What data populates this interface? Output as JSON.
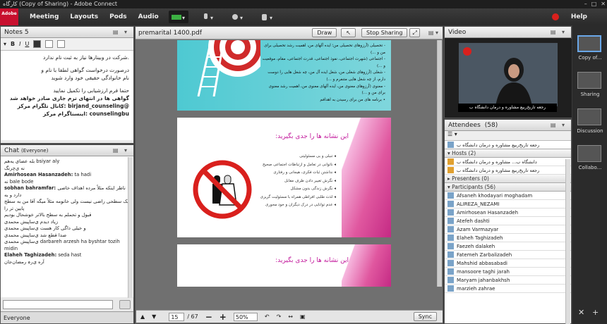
{
  "window": {
    "title": "کارگاه (Copy of Sharing) - Adobe Connect"
  },
  "menu": {
    "items": [
      "Meeting",
      "Layouts",
      "Pods",
      "Audio"
    ],
    "help": "Help"
  },
  "brand": {
    "logo_text": "Adobe"
  },
  "notes": {
    "title": "Notes 5",
    "lines": [
      {
        "text": ".شرکت در وبینارها نیاز به ثبت نام ندارد",
        "bold": false
      },
      {
        "text": "",
        "bold": false
      },
      {
        "text": "درصورت درخواست گواهی لطفا با نام و",
        "bold": false
      },
      {
        "text": "نام خانوادگی حقیقی خود وارد شوید",
        "bold": false
      },
      {
        "text": "",
        "bold": false
      },
      {
        "text": "حتما فرم ارزشیابی را تکمیل نمایید",
        "bold": false
      },
      {
        "text": "گواهی ها در انتهای ترم جاری صادر خواهد شد",
        "bold": true
      },
      {
        "text": "@birjand_counseling :کانال تلگرام مرکز",
        "bold": true
      },
      {
        "text": "counselingbu :اینستاگرام مرکز",
        "bold": true
      }
    ]
  },
  "chat": {
    "title": "Chat",
    "scope": "(Everyone)",
    "footer_label": "Everyone",
    "messages": [
      {
        "who": "",
        "text": "بله عصای یه‌هم bsiyar aly"
      },
      {
        "who": "",
        "text": "نه ی‌چرنگ"
      },
      {
        "who": "Amirhosean Hasanzadeh:",
        "text": " ta hadi"
      },
      {
        "who": "",
        "text": "نه bale bode"
      },
      {
        "who": "sobhan bahramfar:",
        "text": " ناظر اینکه مثلاً مرده اهداف خاصی دارد و به"
      },
      {
        "who": "",
        "text": "یک سطحی راضی نیست ولی خانومه مثلاً میگه آقا من به سطح پایین تر را"
      },
      {
        "who": "",
        "text": "قبول و تحملم به سطح بالاتر خوشحال بودیم"
      },
      {
        "who": "",
        "text": "زیاد دیدم ی‌ساپیش محمد‌ی"
      },
      {
        "who": "",
        "text": "و خیلی داگی کار هست ی‌ساپیش محمد‌ی"
      },
      {
        "who": "",
        "text": "صدا قطع شد ی‌ساپیش محمد‌ی"
      },
      {
        "who": "",
        "text": "ی‌ساپیش محمد‌ی darbareh arzesh ha byshtar tozih midin"
      },
      {
        "who": "Elaheh Taghizadeh:",
        "text": " seda hast"
      },
      {
        "who": "",
        "text": "آره ی‌رہ رمضان‌جان"
      }
    ]
  },
  "share": {
    "file_name": "premarital 1400.pdf",
    "draw_label": "Draw",
    "stop_label": "Stop Sharing",
    "page_current": "15",
    "page_total": "/ 67",
    "zoom": "50%",
    "sync_label": "Sync",
    "slide1_bullets": [
      "- تحصیلی (آرزوهای تحصیلی من؛ ایده آلهای من، اهمیت رشد تحصیلی برای من و ...)",
      "- اجتماعی (شهرت اجتماعی، نفوذ اجتماعی، قدرت اجتماعی، مقام، موقعیت و ...)",
      "- شغلی (آرزوهای شغلی من، شغل ایده آل من، چه شغل هایی را دوست دارم، از چه شغل هایی متنفرم و ...)",
      "- معنوی (آرزوهای معنوی من، ایده آلهای معنوی من، اهمیت رشد معنوی برای من و ...)",
      "• برنامه های من برای رسیدن به اهدافم"
    ],
    "slide2_title": "این نشانه ها را جدی بگیرید:",
    "slide2_bullets": [
      "تنبلی و بی مسئولیتی",
      "ناتوانی در تعامل و ارتباطات اجتماعی صحیح",
      "نداشتن ثبات فکری، هیجانی و رفتاری",
      "نگرش تغییر دادن طرف مقابل",
      "نگرش زندگی بدون مشکل",
      "لذت طلبی افراطی همراه با مسئولیت گریزی",
      "عدم توانایی در درک دیگران و خود محوری"
    ],
    "slide3_title": "این نشانه ها را جدی بگیرید:"
  },
  "video": {
    "title": "Video",
    "caption": "رجعه تاریخ‌ربیع مشاوره و درمان دانشگاه ب"
  },
  "attendees": {
    "title": "Attendees",
    "count": "(58)",
    "me": "رجعه تاریخ‌ربیع مشاوره و درمان دانشگاه ب",
    "hosts_label": "Hosts (2)",
    "hosts": [
      "دانشگاه ب... مشاوره و درمان دانشگاه ب",
      "رجعه تاریخ‌ربیع مشاوره و درمان دانشگاه ب"
    ],
    "presenters_label": "Presenters (0)",
    "participants_label": "Participants (56)",
    "participants": [
      "Afsaneh khodayari moghadam",
      "ALIREZA_NEZAMI",
      "Amirhosean Hasanzadeh",
      "Atefeh dashti",
      "Azam Varmazyar",
      "Elaheh Taghizadeh",
      "Faezeh dalakeh",
      "Fatemeh Zarbalizadeh",
      "Mahshid abbasabadi",
      "mansoore taghi jarah",
      "Maryam jahanbakhsh",
      "marzieh zahrae"
    ]
  },
  "layouts": [
    {
      "label": "Copy of..."
    },
    {
      "label": "Sharing"
    },
    {
      "label": "Discussion"
    },
    {
      "label": "Collabo..."
    }
  ],
  "colors": {
    "accent_pink": "#c2189b",
    "slide_teal": "#4ec9d2",
    "record_red": "#d9201d"
  }
}
